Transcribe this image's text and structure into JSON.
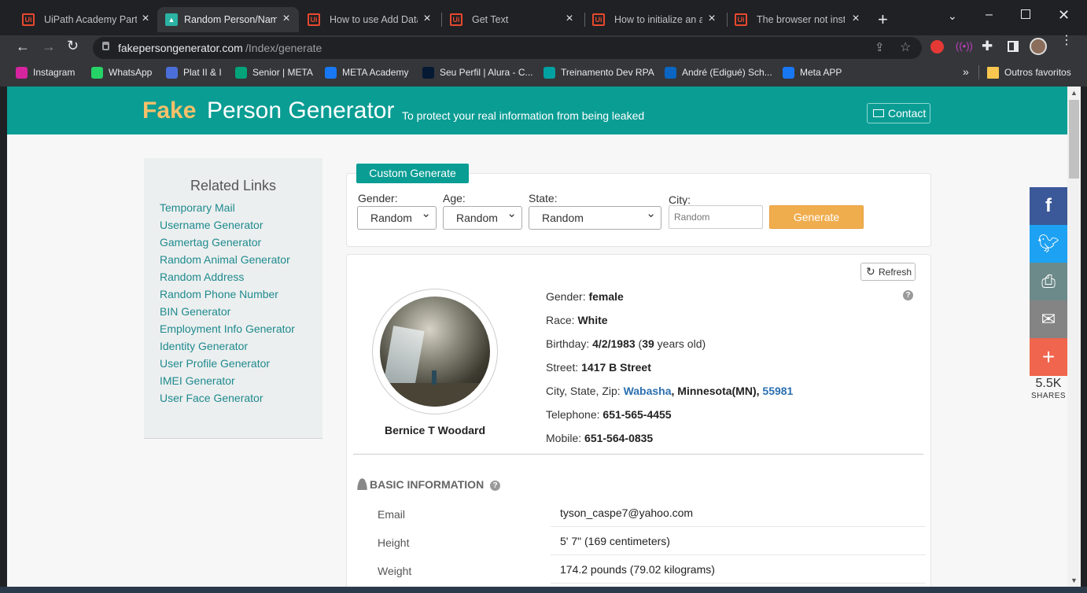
{
  "browser": {
    "tabs": [
      {
        "label": "UiPath Academy Partn",
        "active": false
      },
      {
        "label": "Random Person/Name",
        "active": true
      },
      {
        "label": "How to use Add Data",
        "active": false
      },
      {
        "label": "Get Text",
        "active": false
      },
      {
        "label": "How to initialize an ar",
        "active": false
      },
      {
        "label": "The browser not insta",
        "active": false
      }
    ],
    "new_tab": "+",
    "url_domain": "fakepersongenerator.com",
    "url_path": "/Index/generate",
    "bookmarks": [
      {
        "label": "Instagram",
        "color": "#d6249f"
      },
      {
        "label": "WhatsApp",
        "color": "#25d366"
      },
      {
        "label": "Plat II & I",
        "color": "#4a6fd8"
      },
      {
        "label": "Senior | META",
        "color": "#00a37a"
      },
      {
        "label": "META Academy",
        "color": "#1877f2"
      },
      {
        "label": "Seu Perfil | Alura - C...",
        "color": "#051933"
      },
      {
        "label": "Treinamento Dev RPA",
        "color": "#00a1a1"
      },
      {
        "label": "André (Edigué) Sch...",
        "color": "#0a66c2"
      },
      {
        "label": "Meta APP",
        "color": "#1877f2"
      }
    ],
    "bookmarks_more": "»",
    "other_bookmarks": "Outros favoritos"
  },
  "header": {
    "brand_fake": "Fake",
    "brand_rest": "Person Generator",
    "tagline": "To protect your real information from being leaked",
    "contact": "Contact"
  },
  "sidebar": {
    "title": "Related Links",
    "links": [
      "Temporary Mail",
      "Username Generator",
      "Gamertag Generator",
      "Random Animal Generator",
      "Random Address",
      "Random Phone Number",
      "BIN Generator",
      "Employment Info Generator",
      "Identity Generator",
      "User Profile Generator",
      "IMEI Generator",
      "User Face Generator"
    ]
  },
  "form": {
    "tab": "Custom Generate",
    "gender_label": "Gender:",
    "gender_value": "Random",
    "age_label": "Age:",
    "age_value": "Random",
    "state_label": "State:",
    "state_value": "Random",
    "city_label": "City:",
    "city_placeholder": "Random",
    "generate": "Generate"
  },
  "person": {
    "refresh": "Refresh",
    "name": "Bernice T Woodard",
    "gender_label": "Gender:",
    "gender": "female",
    "race_label": "Race:",
    "race": "White",
    "birthday_label": "Birthday:",
    "birthday": "4/2/1983",
    "age_open": "(",
    "age": "39",
    "age_suffix": "years old)",
    "street_label": "Street:",
    "street": "1417 B Street",
    "csz_label": "City, State, Zip:",
    "city": "Wabasha",
    "state": "Minnesota(MN)",
    "zip": "55981",
    "telephone_label": "Telephone:",
    "telephone": "651-565-4455",
    "mobile_label": "Mobile:",
    "mobile": "651-564-0835"
  },
  "basic": {
    "heading": "BASIC INFORMATION",
    "rows": [
      {
        "label": "Email",
        "value": "tyson_caspe7@yahoo.com"
      },
      {
        "label": "Height",
        "value": "5' 7\" (169 centimeters)"
      },
      {
        "label": "Weight",
        "value": "174.2 pounds (79.02 kilograms)"
      }
    ]
  },
  "share": {
    "count": "5.5K",
    "label": "SHARES",
    "colors": {
      "facebook": "#3b5998",
      "twitter": "#1da1f2",
      "print": "#6d8a8a",
      "email": "#848484",
      "more": "#f0654d"
    }
  },
  "colors": {
    "teal": "#0a9d94",
    "brand_orange": "#f5c06a",
    "generate": "#f0ad4e"
  }
}
